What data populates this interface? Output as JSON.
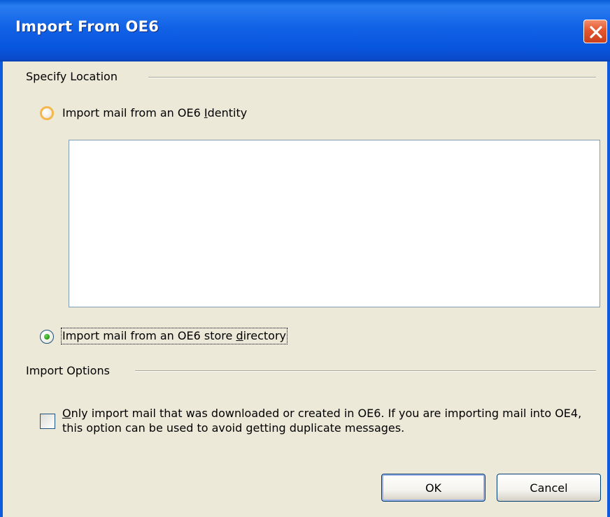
{
  "window": {
    "title": "Import From OE6",
    "close_icon": "close-icon"
  },
  "specify_location": {
    "label": "Specify Location",
    "option_identity": {
      "prefix": "Import mail from an OE6 ",
      "accel": "I",
      "suffix": "dentity",
      "selected": false
    },
    "identity_list": {
      "items": []
    },
    "option_store": {
      "prefix": "Import mail from an OE6 store ",
      "accel": "d",
      "suffix": "irectory",
      "selected": true
    }
  },
  "import_options": {
    "label": "Import Options",
    "only_oe6": {
      "accel": "O",
      "text": "nly import mail that was downloaded or created in OE6. If you are importing mail into OE4, this option can be used to avoid getting duplicate messages.",
      "checked": false
    }
  },
  "buttons": {
    "ok": "OK",
    "cancel": "Cancel"
  }
}
